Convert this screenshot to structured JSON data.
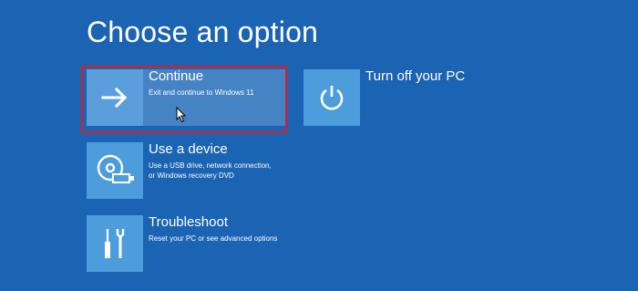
{
  "screen": {
    "title": "Choose an option"
  },
  "options": {
    "continue": {
      "title": "Continue",
      "description": "Exit and continue to Windows 11",
      "icon": "arrow-right-icon"
    },
    "use_device": {
      "title": "Use a device",
      "description": "Use a USB drive, network connection,\nor Windows recovery DVD",
      "icon": "disc-usb-icon"
    },
    "troubleshoot": {
      "title": "Troubleshoot",
      "description": "Reset your PC or see advanced options",
      "icon": "tools-icon"
    },
    "turn_off": {
      "title": "Turn off your PC",
      "icon": "power-icon"
    }
  },
  "colors": {
    "background": "#1b63b3",
    "tile": "#4d9cdb",
    "selected_tile": "#4683c5",
    "selection_border": "#e11b24",
    "text": "#ffffff"
  }
}
